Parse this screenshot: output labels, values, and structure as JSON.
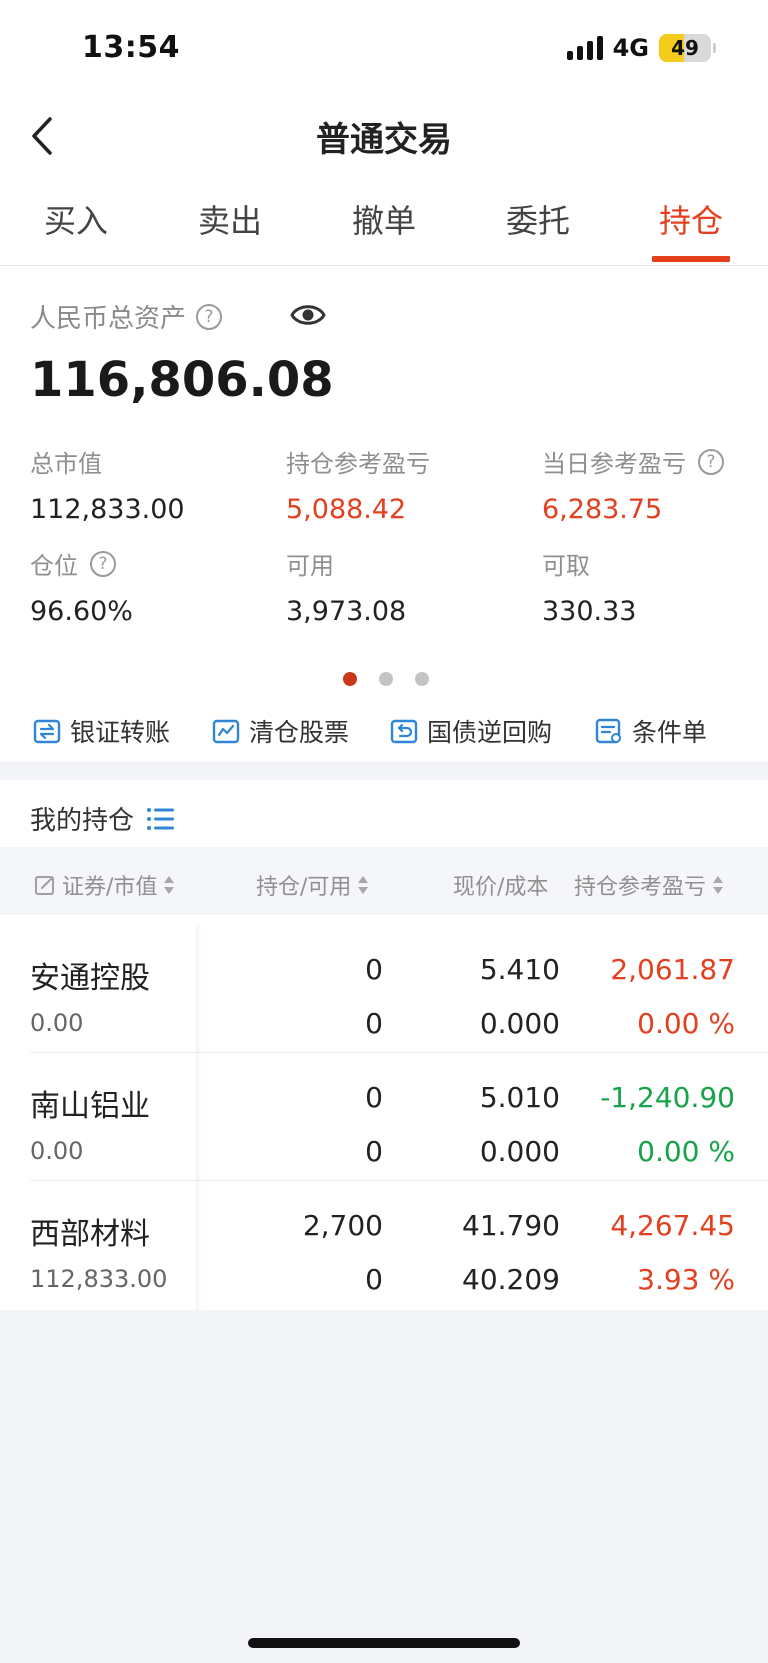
{
  "status": {
    "time": "13:54",
    "network": "4G",
    "battery": "49",
    "battery_fraction": 0.49
  },
  "nav": {
    "title": "普通交易"
  },
  "tabs": [
    {
      "label": "买入"
    },
    {
      "label": "卖出"
    },
    {
      "label": "撤单"
    },
    {
      "label": "委托"
    },
    {
      "label": "持仓",
      "active": true
    }
  ],
  "assets": {
    "label": "人民币总资产",
    "total": "116,806.08",
    "stats": [
      {
        "label": "总市值",
        "value": "112,833.00"
      },
      {
        "label": "持仓参考盈亏",
        "value": "5,088.42"
      },
      {
        "label": "当日参考盈亏",
        "value": "6,283.75"
      },
      {
        "label": "仓位",
        "value": "96.60%"
      },
      {
        "label": "可用",
        "value": "3,973.08"
      },
      {
        "label": "可取",
        "value": "330.33"
      }
    ]
  },
  "quick_actions": [
    {
      "label": "银证转账",
      "icon": "transfer-icon"
    },
    {
      "label": "清仓股票",
      "icon": "clear-chart-icon"
    },
    {
      "label": "国债逆回购",
      "icon": "repo-icon"
    },
    {
      "label": "条件单",
      "icon": "condition-order-icon"
    }
  ],
  "holdings": {
    "title": "我的持仓",
    "columns": [
      "证券/市值",
      "持仓/可用",
      "现价/成本",
      "持仓参考盈亏"
    ],
    "rows": [
      {
        "name": "安通控股",
        "market_value": "0.00",
        "position": "0",
        "available": "0",
        "price": "5.410",
        "cost": "0.000",
        "pnl": "2,061.87",
        "pnl_pct": "0.00 %",
        "trend": "up"
      },
      {
        "name": "南山铝业",
        "market_value": "0.00",
        "position": "0",
        "available": "0",
        "price": "5.010",
        "cost": "0.000",
        "pnl": "-1,240.90",
        "pnl_pct": "0.00 %",
        "trend": "down"
      },
      {
        "name": "西部材料",
        "market_value": "112,833.00",
        "position": "2,700",
        "available": "0",
        "price": "41.790",
        "cost": "40.209",
        "pnl": "4,267.45",
        "pnl_pct": "3.93 %",
        "trend": "up"
      }
    ]
  },
  "colors": {
    "accent": "#e2401f",
    "loss": "#17a34a",
    "icon_blue": "#2f86d6"
  }
}
